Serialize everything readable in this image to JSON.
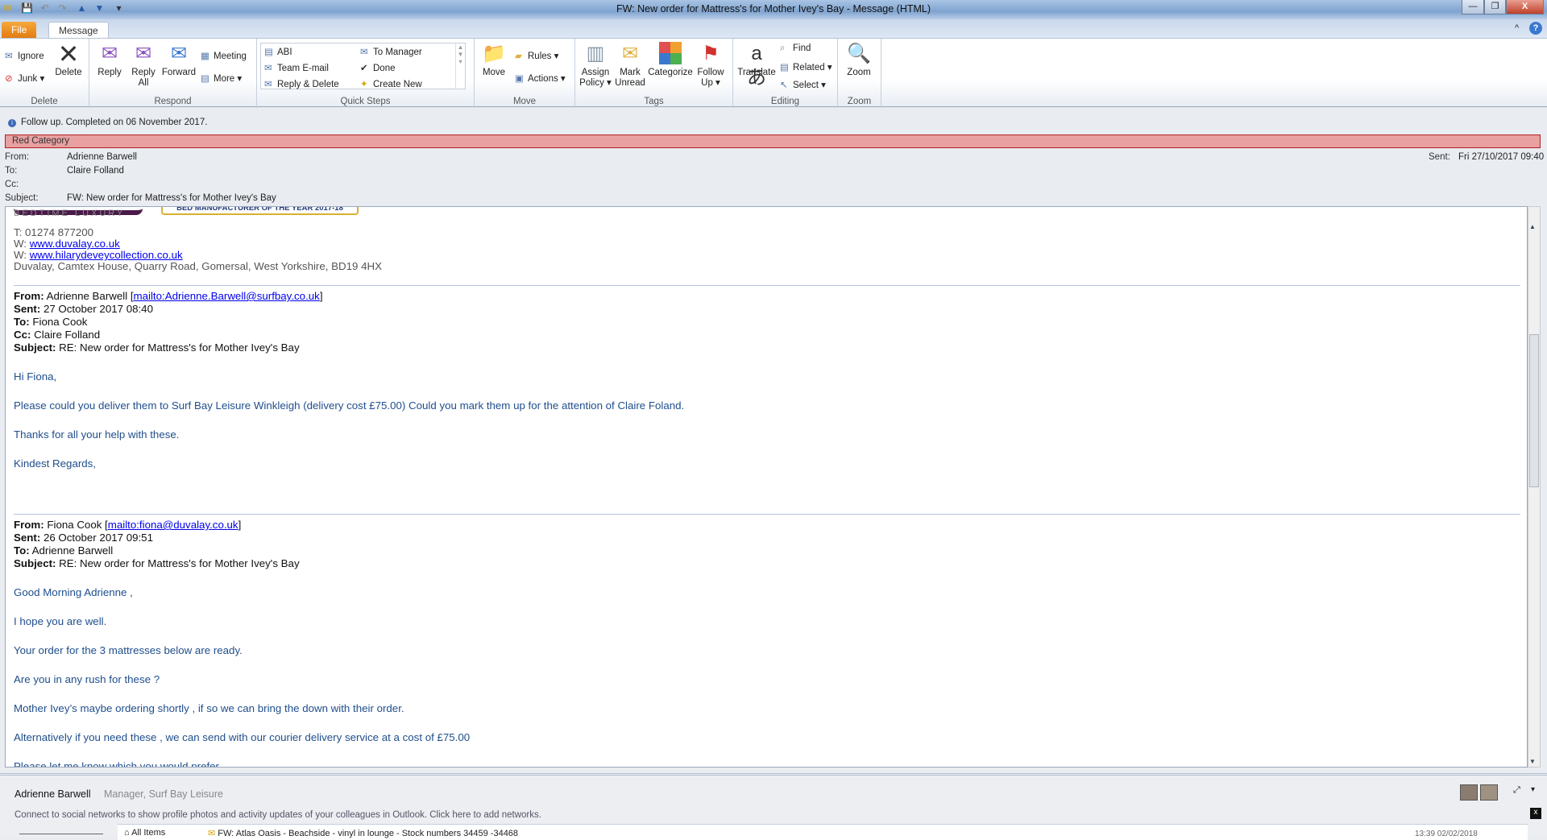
{
  "window": {
    "title": "FW: New order for Mattress's for Mother Ivey's Bay  -  Message (HTML)",
    "minimize": "—",
    "restore": "❐",
    "close": "X"
  },
  "tabs": {
    "file": "File",
    "message": "Message"
  },
  "ribbon": {
    "delete": {
      "label": "Delete",
      "ignore": "Ignore",
      "junk": "Junk ▾",
      "delete": "Delete"
    },
    "respond": {
      "label": "Respond",
      "reply": "Reply",
      "reply_all": "Reply All",
      "forward": "Forward",
      "meeting": "Meeting",
      "more": "More ▾"
    },
    "quick_steps": {
      "label": "Quick Steps",
      "items": [
        "ABI",
        "To Manager",
        "Team E-mail",
        "Done",
        "Reply & Delete",
        "Create New"
      ]
    },
    "move": {
      "label": "Move",
      "move": "Move",
      "rules": "Rules ▾",
      "actions": "Actions ▾"
    },
    "tags": {
      "label": "Tags",
      "assign_policy": "Assign Policy ▾",
      "mark_unread": "Mark Unread",
      "categorize": "Categorize",
      "follow_up": "Follow Up ▾"
    },
    "editing": {
      "label": "Editing",
      "translate": "Translate",
      "find": "Find",
      "related": "Related ▾",
      "select": "Select ▾"
    },
    "zoom": {
      "label": "Zoom",
      "zoom": "Zoom"
    }
  },
  "info_bar": "Follow up.  Completed on 06 November 2017.",
  "category": {
    "label": "Red Category",
    "color": "#e8a0a0"
  },
  "header": {
    "from_label": "From:",
    "from": "Adrienne Barwell",
    "to_label": "To:",
    "to": "Claire Folland",
    "cc_label": "Cc:",
    "cc": "",
    "subject_label": "Subject:",
    "subject": "FW: New order for Mattress's for Mother Ivey's Bay",
    "sent_label": "Sent:",
    "sent": "Fri 27/10/2017 09:40"
  },
  "body": {
    "logo_tagline": "BEDTIME LUXURY",
    "award": "BED MANUFACTURER OF THE YEAR 2017-18",
    "sig_phone": "T: 01274 877200",
    "sig_w1_label": "W: ",
    "sig_w1": "www.duvalay.co.uk",
    "sig_w2_label": "W: ",
    "sig_w2": "www.hilarydeveycollection.co.uk",
    "sig_address": "Duvalay, Camtex House, Quarry Road, Gomersal, West Yorkshire, BD19 4HX",
    "msg1": {
      "from_label": "From:",
      "from": " Adrienne Barwell [",
      "from_link": "mailto:Adrienne.Barwell@surfbay.co.uk",
      "sent_label": "Sent:",
      "sent": " 27 October 2017 08:40",
      "to_label": "To:",
      "to": " Fiona Cook",
      "cc_label": "Cc:",
      "cc": " Claire Folland",
      "subject_label": "Subject:",
      "subject": " RE: New order for Mattress's for Mother Ivey's Bay",
      "lines": [
        "Hi Fiona,",
        "Please could you deliver them to Surf Bay Leisure Winkleigh (delivery cost £75.00) Could you mark them up for the attention of Claire Foland.",
        "Thanks for all your help with these.",
        "Kindest Regards,"
      ]
    },
    "msg2": {
      "from_label": "From:",
      "from": " Fiona Cook [",
      "from_link": "mailto:fiona@duvalay.co.uk",
      "sent_label": "Sent:",
      "sent": " 26 October 2017 09:51",
      "to_label": "To:",
      "to": " Adrienne Barwell",
      "subject_label": "Subject:",
      "subject": " RE: New order for Mattress's for Mother Ivey's Bay",
      "lines": [
        "Good Morning Adrienne ,",
        "I hope you are well.",
        "Your order for the 3 mattresses below are ready.",
        "Are you in any rush for these ?",
        "Mother Ivey’s maybe ordering shortly , if so we can bring the down with their order.",
        "Alternatively if you need these , we can send with our courier delivery service at a cost of £75.00",
        "Please let me know which you would prefer"
      ]
    }
  },
  "people_pane": {
    "name": "Adrienne Barwell",
    "title": "Manager, Surf Bay Leisure",
    "connect": "Connect to social networks to show profile photos and activity updates of your colleagues in Outlook. Click here to add networks.",
    "folder": "All Items",
    "next_item": "FW: Atlas Oasis - Beachside - vinyl in lounge - Stock numbers 34459 -34468",
    "next_time": "13:39 02/02/2018"
  }
}
